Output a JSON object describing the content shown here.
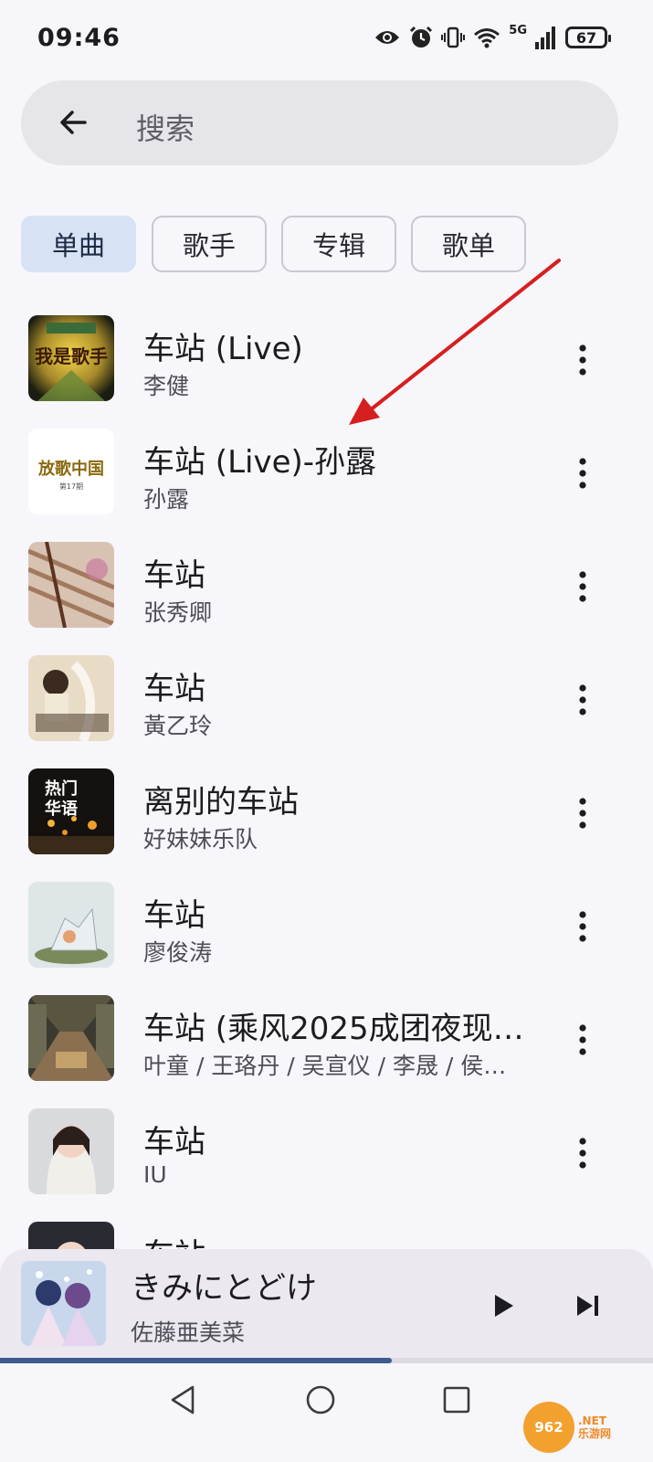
{
  "status_bar": {
    "time": "09:46",
    "network": "5G",
    "battery": "67"
  },
  "search": {
    "placeholder": "搜索"
  },
  "filters": [
    {
      "label": "单曲",
      "active": true
    },
    {
      "label": "歌手",
      "active": false
    },
    {
      "label": "专辑",
      "active": false
    },
    {
      "label": "歌单",
      "active": false
    }
  ],
  "songs": [
    {
      "title": "车站 (Live)",
      "artist": "李健",
      "cover_text": "我是歌手"
    },
    {
      "title": "车站 (Live)-孙露",
      "artist": "孙露",
      "cover_text": "放歌中国",
      "cover_sub": "第17期"
    },
    {
      "title": "车站",
      "artist": "张秀卿"
    },
    {
      "title": "车站",
      "artist": "黃乙玲"
    },
    {
      "title": "离别的车站",
      "artist": "好妹妹乐队",
      "cover_text": "热门",
      "cover_text2": "华语"
    },
    {
      "title": "车站",
      "artist": "廖俊涛"
    },
    {
      "title": "车站 (乘风2025成团夜现…",
      "artist": "叶童 / 王珞丹 / 吴宣仪 / 李晟 / 侯…"
    },
    {
      "title": "车站",
      "artist": "IU"
    },
    {
      "title": "车站",
      "artist": ""
    }
  ],
  "now_playing": {
    "title": "きみにとどけ",
    "artist": "佐藤亜美菜",
    "progress": 0.6
  },
  "watermark": {
    "logo": "962",
    "suffix": ".NET",
    "sub": "乐游网"
  },
  "colors": {
    "accent": "#3e5b90",
    "chip_active": "#d8e2f5",
    "arrow": "#d61f1f"
  }
}
